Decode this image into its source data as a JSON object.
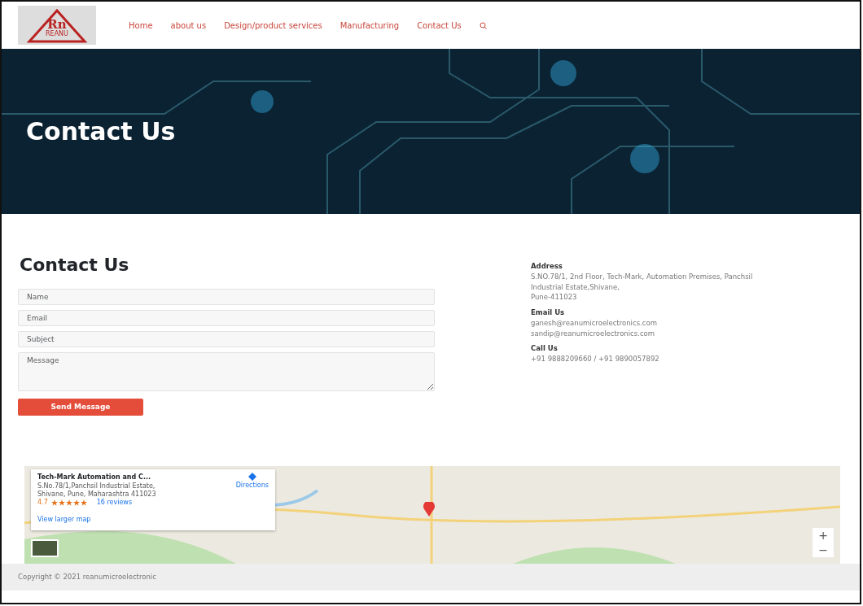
{
  "header": {
    "logo_text": "Rn",
    "logo_caption": "REANU",
    "nav": [
      {
        "label": "Home"
      },
      {
        "label": "about us"
      },
      {
        "label": "Design/product services"
      },
      {
        "label": "Manufacturing"
      },
      {
        "label": "Contact Us"
      }
    ]
  },
  "hero": {
    "title": "Contact Us"
  },
  "form": {
    "heading": "Contact Us",
    "fields": [
      {
        "kind": "input",
        "placeholder": "Name"
      },
      {
        "kind": "input",
        "placeholder": "Email"
      },
      {
        "kind": "input",
        "placeholder": "Subject"
      },
      {
        "kind": "textarea",
        "placeholder": "Message"
      }
    ],
    "submit": "Send Message"
  },
  "contact": [
    {
      "title": "Address",
      "lines": [
        "S.NO.78/1, 2nd Floor, Tech-Mark, Automation Premises, Panchsil",
        "Industrial Estate,Shivane,",
        "Pune-411023"
      ]
    },
    {
      "title": "Email Us",
      "lines": [
        "ganesh@reanumicroelectronics.com",
        "sandip@reanumicroelectronics.com"
      ]
    },
    {
      "title": "Call Us",
      "lines": [
        "+91 9888209660 / +91 9890057892"
      ]
    }
  ],
  "map": {
    "card": {
      "title": "Tech-Mark Automation and C...",
      "address": [
        "S.No.78/1,Panchsil Industrial Estate,",
        "Shivane, Pune, Maharashtra 411023"
      ],
      "rating": "4.7",
      "stars": 5,
      "reviews": "16 reviews",
      "directions": "Directions",
      "larger": "View larger map"
    },
    "zoom_in": "+",
    "zoom_out": "−"
  },
  "footer": {
    "copyright": "Copyright © 2021 reanumicroelectronic"
  }
}
